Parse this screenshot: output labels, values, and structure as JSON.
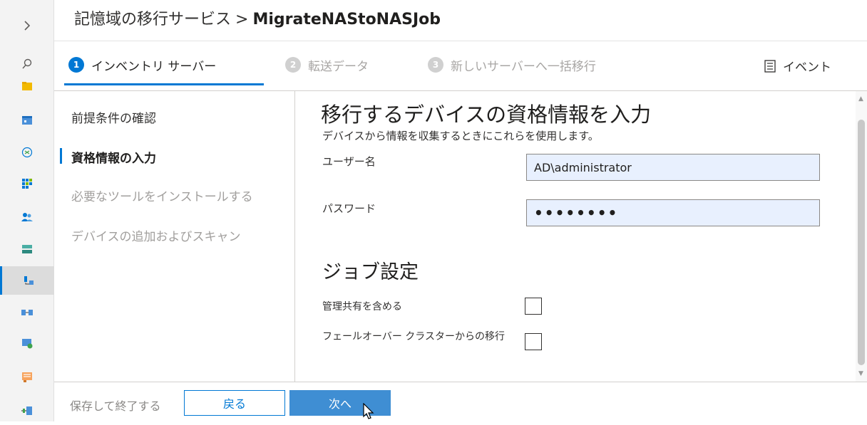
{
  "breadcrumb": {
    "service": "記憶域の移行サービス",
    "separator": ">",
    "job": "MigrateNAStoNASJob"
  },
  "steps": [
    {
      "number": "1",
      "label": "インベントリ サーバー",
      "state": "active"
    },
    {
      "number": "2",
      "label": "転送データ",
      "state": "inactive"
    },
    {
      "number": "3",
      "label": "新しいサーバーへ一括移行",
      "state": "inactive"
    }
  ],
  "events_label": "イベント",
  "left_nav": [
    {
      "label": "前提条件の確認",
      "state": "done"
    },
    {
      "label": "資格情報の入力",
      "state": "current"
    },
    {
      "label": "必要なツールをインストールする",
      "state": "future"
    },
    {
      "label": "デバイスの追加およびスキャン",
      "state": "future"
    }
  ],
  "main": {
    "title": "移行するデバイスの資格情報を入力",
    "subtitle": "デバイスから情報を収集するときにこれらを使用します。",
    "username_label": "ユーザー名",
    "username_value": "AD\\administrator",
    "password_label": "パスワード",
    "password_value": "••••••••",
    "job_settings_title": "ジョブ設定",
    "include_admin_shares_label": "管理共有を含める",
    "include_admin_shares_checked": false,
    "failover_cluster_label": "フェールオーバー クラスターからの移行",
    "failover_cluster_checked": false
  },
  "footer": {
    "save_exit": "保存して終了する",
    "back": "戻る",
    "next": "次へ"
  },
  "rail_icons": [
    "expand-chevron-icon",
    "search-icon",
    "folder-icon",
    "dashboard-icon",
    "globe-icon",
    "apps-icon",
    "users-icon",
    "storage-icon",
    "migration-icon",
    "sync-icon",
    "vm-icon",
    "reports-icon",
    "network-icon"
  ],
  "colors": {
    "accent": "#0078d4",
    "next_button": "#3f8ed3",
    "input_fill": "#e8f0fe"
  }
}
